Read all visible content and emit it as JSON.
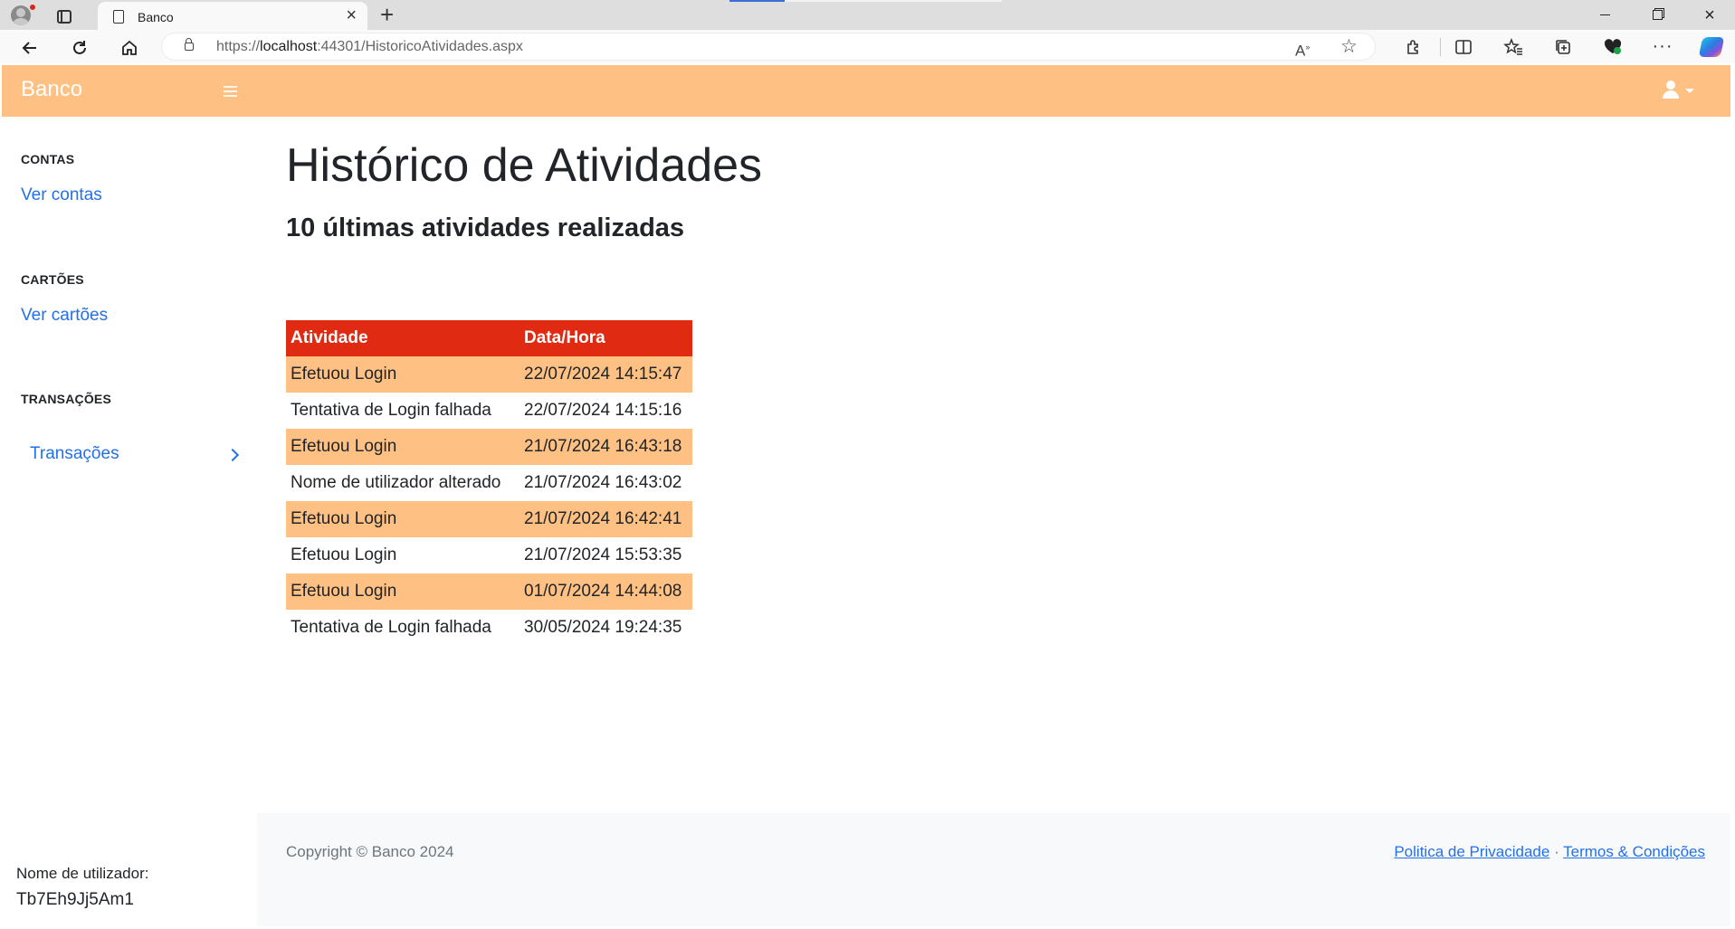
{
  "browser": {
    "tab_title": "Banco",
    "new_tab_symbol": "+",
    "close_symbol": "×",
    "url_scheme": "https://",
    "url_host": "localhost",
    "url_rest": ":44301/HistoricoAtividades.aspx",
    "icons": [
      "profile-icon",
      "tab-actions-icon",
      "page-icon",
      "back-icon",
      "refresh-icon",
      "home-icon",
      "lock-icon",
      "read-aloud-icon",
      "favorite-star-icon",
      "extensions-icon",
      "split-screen-icon",
      "favorites-icon",
      "collections-icon",
      "browser-essentials-icon",
      "more-icon",
      "copilot-icon"
    ]
  },
  "app": {
    "brand": "Banco",
    "brand_color": "#ffc183",
    "accent_red": "#e02b12",
    "link_color": "#2371e8"
  },
  "sidebar": {
    "sections": [
      {
        "heading": "CONTAS",
        "link": "Ver contas"
      },
      {
        "heading": "CARTÕES",
        "link": "Ver cartões"
      },
      {
        "heading": "TRANSAÇÕES",
        "link": "Transações"
      }
    ],
    "username_label": "Nome de utilizador:",
    "username_value": "Tb7Eh9Jj5Am1"
  },
  "main": {
    "title": "Histórico de Atividades",
    "subtitle": "10 últimas atividades realizadas",
    "table": {
      "headers": [
        "Atividade",
        "Data/Hora"
      ],
      "rows": [
        [
          "Efetuou Login",
          "22/07/2024 14:15:47"
        ],
        [
          "Tentativa de Login falhada",
          "22/07/2024 14:15:16"
        ],
        [
          "Efetuou Login",
          "21/07/2024 16:43:18"
        ],
        [
          "Nome de utilizador alterado",
          "21/07/2024 16:43:02"
        ],
        [
          "Efetuou Login",
          "21/07/2024 16:42:41"
        ],
        [
          "Efetuou Login",
          "21/07/2024 15:53:35"
        ],
        [
          "Efetuou Login",
          "01/07/2024 14:44:08"
        ],
        [
          "Tentativa de Login falhada",
          "30/05/2024 19:24:35"
        ]
      ]
    }
  },
  "footer": {
    "copyright": "Copyright © Banco 2024",
    "privacy": "Politica de Privacidade",
    "separator": "·",
    "terms": "Termos & Condições"
  }
}
